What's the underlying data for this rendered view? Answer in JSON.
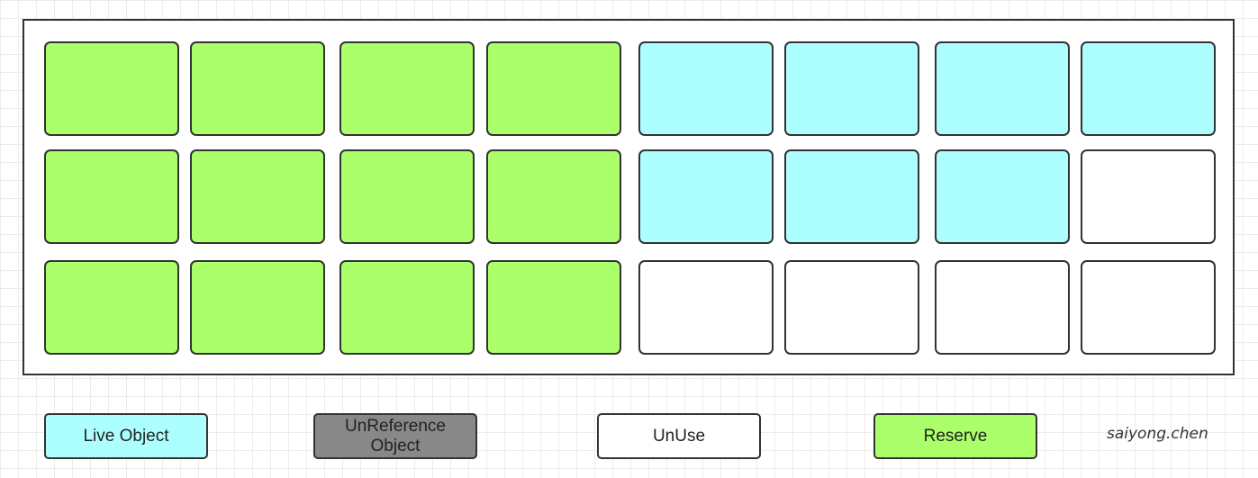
{
  "colors": {
    "reserve": "#aaff6b",
    "live": "#adffff",
    "unuse": "#ffffff",
    "unreference": "#888888"
  },
  "grid": {
    "rows": [
      [
        "reserve",
        "reserve",
        "reserve",
        "reserve",
        "live",
        "live",
        "live",
        "live"
      ],
      [
        "reserve",
        "reserve",
        "reserve",
        "reserve",
        "live",
        "live",
        "live",
        "unuse"
      ],
      [
        "reserve",
        "reserve",
        "reserve",
        "reserve",
        "unuse",
        "unuse",
        "unuse",
        "unuse"
      ]
    ]
  },
  "legend": {
    "items": [
      {
        "key": "live",
        "label": "Live Object"
      },
      {
        "key": "unreference",
        "label": "UnReference Object"
      },
      {
        "key": "unuse",
        "label": "UnUse"
      },
      {
        "key": "reserve",
        "label": "Reserve"
      }
    ]
  },
  "signature": "saiyong.chen"
}
